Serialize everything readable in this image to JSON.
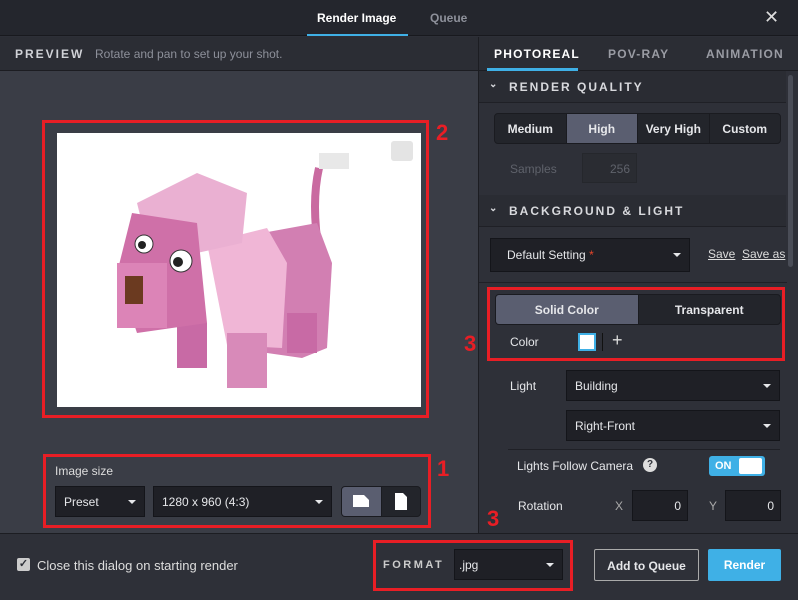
{
  "header": {
    "tabs": [
      {
        "label": "Render Image",
        "active": true
      },
      {
        "label": "Queue",
        "active": false
      }
    ],
    "close_icon": "close-icon"
  },
  "preview": {
    "title": "PREVIEW",
    "hint": "Rotate and pan to set up your shot.",
    "image_size_label": "Image size",
    "preset": "Preset",
    "size": "1280 x 960 (4:3)",
    "orientation": [
      "landscape",
      "portrait"
    ],
    "orientation_selected": "landscape"
  },
  "settings_tabs": [
    {
      "label": "PHOTOREAL",
      "active": true
    },
    {
      "label": "POV-RAY",
      "active": false
    },
    {
      "label": "ANIMATION",
      "active": false
    }
  ],
  "render_quality": {
    "title": "RENDER QUALITY",
    "options": [
      "Medium",
      "High",
      "Very High",
      "Custom"
    ],
    "selected": "High",
    "samples_label": "Samples",
    "samples": "256"
  },
  "background_light": {
    "title": "BACKGROUND & LIGHT",
    "preset": "Default Setting",
    "modified_mark": "*",
    "save": "Save",
    "save_as": "Save as",
    "bg_options": [
      "Solid Color",
      "Transparent"
    ],
    "bg_selected": "Solid Color",
    "color_label": "Color",
    "color_value": "#ffffff",
    "add": "+",
    "light_label": "Light",
    "light": "Building",
    "light_direction": "Right-Front",
    "follow_label": "Lights Follow Camera",
    "follow_toggle": "ON",
    "rotation_label": "Rotation",
    "x_label": "X",
    "x": "0",
    "y_label": "Y",
    "y": "0"
  },
  "footer": {
    "close_on_render": "Close this dialog on starting render",
    "close_checked": true,
    "format_label": "FORMAT",
    "format": ".jpg",
    "add_queue": "Add to Queue",
    "render": "Render"
  },
  "annotations": [
    "1",
    "2",
    "3",
    "3"
  ],
  "colors": {
    "accent": "#3fb0e6",
    "annotation": "#e81e25"
  }
}
